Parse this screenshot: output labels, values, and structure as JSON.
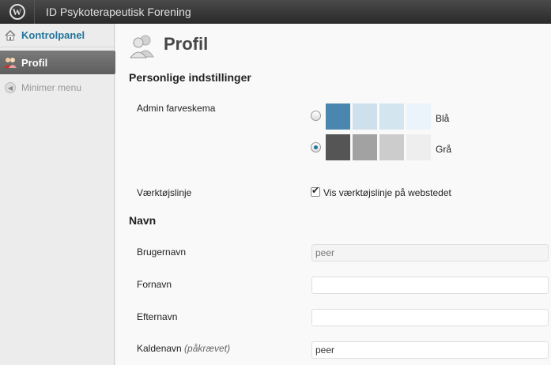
{
  "adminbar": {
    "site_name": "ID Psykoterapeutisk Forening",
    "logo_glyph": "W"
  },
  "sidebar": {
    "items": [
      {
        "label": "Kontrolpanel",
        "icon": "home-icon"
      },
      {
        "label": "Profil",
        "icon": "users-icon"
      },
      {
        "label": "Minimer menu",
        "icon": "collapse-icon"
      }
    ]
  },
  "main": {
    "title": "Profil",
    "personal_heading": "Personlige indstillinger",
    "color_scheme_label": "Admin farveskema",
    "schemes": [
      {
        "name": "Blå",
        "selected": false,
        "colors": [
          "#4a86ad",
          "#cde0ec",
          "#d3e6f0",
          "#ebf4fa"
        ]
      },
      {
        "name": "Grå",
        "selected": true,
        "colors": [
          "#555555",
          "#a2a2a2",
          "#cccccc",
          "#eeeeee"
        ]
      }
    ],
    "toolbar_label": "Værktøjslinje",
    "toolbar_checkbox_label": "Vis værktøjslinje på webstedet",
    "toolbar_checked": true,
    "name_heading": "Navn",
    "fields": [
      {
        "label": "Brugernavn",
        "value": "peer",
        "disabled": true
      },
      {
        "label": "Fornavn",
        "value": ""
      },
      {
        "label": "Efternavn",
        "value": ""
      },
      {
        "label": "Kaldenavn",
        "required_note": "(påkrævet)",
        "value": "peer"
      }
    ]
  },
  "colors": {
    "link": "#21759b",
    "adminbar": "#2b2b2b"
  }
}
